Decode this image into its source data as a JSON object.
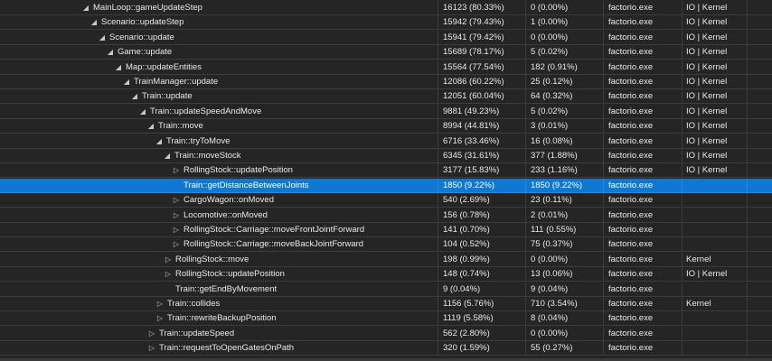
{
  "rows": [
    {
      "name": "MainLoop::gameUpdateStep",
      "expander": "expanded",
      "total": "16123 (80.33%)",
      "self": "0 (0.00%)",
      "module": "factorio.exe",
      "category": "IO | Kernel"
    },
    {
      "name": "Scenario::updateStep",
      "expander": "expanded",
      "total": "15942 (79.43%)",
      "self": "1 (0.00%)",
      "module": "factorio.exe",
      "category": "IO | Kernel"
    },
    {
      "name": "Scenario::update",
      "expander": "expanded",
      "total": "15941 (79.42%)",
      "self": "0 (0.00%)",
      "module": "factorio.exe",
      "category": "IO | Kernel"
    },
    {
      "name": "Game::update",
      "expander": "expanded",
      "total": "15689 (78.17%)",
      "self": "5 (0.02%)",
      "module": "factorio.exe",
      "category": "IO | Kernel"
    },
    {
      "name": "Map::updateEntities",
      "expander": "expanded",
      "total": "15564 (77.54%)",
      "self": "182 (0.91%)",
      "module": "factorio.exe",
      "category": "IO | Kernel"
    },
    {
      "name": "TrainManager::update",
      "expander": "expanded",
      "total": "12086 (60.22%)",
      "self": "25 (0.12%)",
      "module": "factorio.exe",
      "category": "IO | Kernel"
    },
    {
      "name": "Train::update",
      "expander": "expanded",
      "total": "12051 (60.04%)",
      "self": "64 (0.32%)",
      "module": "factorio.exe",
      "category": "IO | Kernel"
    },
    {
      "name": "Train::updateSpeedAndMove",
      "expander": "expanded",
      "total": "9881 (49.23%)",
      "self": "5 (0.02%)",
      "module": "factorio.exe",
      "category": "IO | Kernel"
    },
    {
      "name": "Train::move",
      "expander": "expanded",
      "total": "8994 (44.81%)",
      "self": "3 (0.01%)",
      "module": "factorio.exe",
      "category": "IO | Kernel"
    },
    {
      "name": "Train::tryToMove",
      "expander": "expanded",
      "total": "6716 (33.46%)",
      "self": "16 (0.08%)",
      "module": "factorio.exe",
      "category": "IO | Kernel"
    },
    {
      "name": "Train::moveStock",
      "expander": "expanded",
      "total": "6345 (31.61%)",
      "self": "377 (1.88%)",
      "module": "factorio.exe",
      "category": "IO | Kernel"
    },
    {
      "name": "RollingStock::updatePosition",
      "expander": "collapsed",
      "total": "3177 (15.83%)",
      "self": "233 (1.16%)",
      "module": "factorio.exe",
      "category": "IO | Kernel"
    },
    {
      "name": "Train::getDistanceBetweenJoints",
      "expander": "none",
      "total": "1850 (9.22%)",
      "self": "1850 (9.22%)",
      "module": "factorio.exe",
      "category": "",
      "selected": true
    },
    {
      "name": "CargoWagon::onMoved",
      "expander": "collapsed",
      "total": "540 (2.69%)",
      "self": "23 (0.11%)",
      "module": "factorio.exe",
      "category": ""
    },
    {
      "name": "Locomotive::onMoved",
      "expander": "collapsed",
      "total": "156 (0.78%)",
      "self": "2 (0.01%)",
      "module": "factorio.exe",
      "category": ""
    },
    {
      "name": "RollingStock::Carriage::moveFrontJointForward",
      "expander": "collapsed",
      "total": "141 (0.70%)",
      "self": "111 (0.55%)",
      "module": "factorio.exe",
      "category": ""
    },
    {
      "name": "RollingStock::Carriage::moveBackJointForward",
      "expander": "collapsed",
      "total": "104 (0.52%)",
      "self": "75 (0.37%)",
      "module": "factorio.exe",
      "category": ""
    },
    {
      "name": "RollingStock::move",
      "expander": "collapsed",
      "total": "198 (0.99%)",
      "self": "0 (0.00%)",
      "module": "factorio.exe",
      "category": "Kernel"
    },
    {
      "name": "RollingStock::updatePosition",
      "expander": "collapsed",
      "total": "148 (0.74%)",
      "self": "13 (0.06%)",
      "module": "factorio.exe",
      "category": "IO | Kernel"
    },
    {
      "name": "Train::getEndByMovement",
      "expander": "none",
      "total": "9 (0.04%)",
      "self": "9 (0.04%)",
      "module": "factorio.exe",
      "category": ""
    },
    {
      "name": "Train::collides",
      "expander": "collapsed",
      "total": "1156 (5.76%)",
      "self": "710 (3.54%)",
      "module": "factorio.exe",
      "category": "Kernel"
    },
    {
      "name": "Train::rewriteBackupPosition",
      "expander": "collapsed",
      "total": "1119 (5.58%)",
      "self": "8 (0.04%)",
      "module": "factorio.exe",
      "category": ""
    },
    {
      "name": "Train::updateSpeed",
      "expander": "collapsed",
      "total": "562 (2.80%)",
      "self": "0 (0.00%)",
      "module": "factorio.exe",
      "category": ""
    },
    {
      "name": "Train::requestToOpenGatesOnPath",
      "expander": "collapsed",
      "total": "320 (1.59%)",
      "self": "55 (0.27%)",
      "module": "factorio.exe",
      "category": ""
    }
  ],
  "icons": {
    "expanded": "◢",
    "collapsed": "▷"
  }
}
